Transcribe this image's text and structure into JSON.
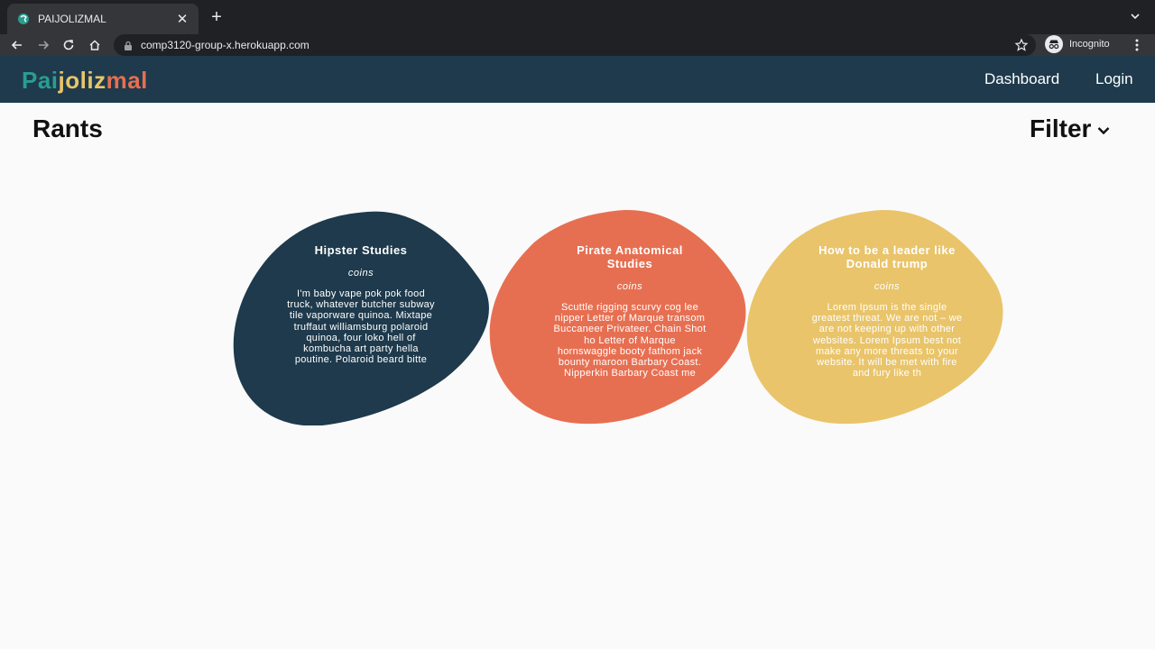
{
  "browser": {
    "tab_title": "PAIJOLIZMAL",
    "url": "comp3120-group-x.herokuapp.com",
    "incognito_label": "Incognito"
  },
  "app": {
    "logo": {
      "part1": "Pai",
      "part2": "joliz",
      "part3": "mal"
    },
    "nav": {
      "dashboard": "Dashboard",
      "login": "Login"
    }
  },
  "page": {
    "title": "Rants",
    "filter_label": "Filter"
  },
  "cards": [
    {
      "title": "Hipster Studies",
      "subtitle": "coins",
      "body": "I'm baby vape pok pok food truck, whatever butcher subway tile vaporware quinoa. Mixtape truffaut williamsburg polaroid quinoa, four loko hell of kombucha art party hella poutine. Polaroid beard bitte",
      "color": "#1e3a4c"
    },
    {
      "title": "Pirate Anatomical Studies",
      "subtitle": "coins",
      "body": "Scuttle rigging scurvy cog lee nipper Letter of Marque transom Buccaneer Privateer. Chain Shot ho Letter of Marque hornswaggle booty fathom jack bounty maroon Barbary Coast. Nipperkin Barbary Coast me",
      "color": "#e76f51"
    },
    {
      "title": "How to be a leader like Donald trump",
      "subtitle": "coins",
      "body": "Lorem Ipsum is the single greatest threat. We are not – we are not keeping up with other websites. Lorem Ipsum best not make any more threats to your website. It will be met with fire and fury like th",
      "color": "#e9c46a"
    }
  ]
}
